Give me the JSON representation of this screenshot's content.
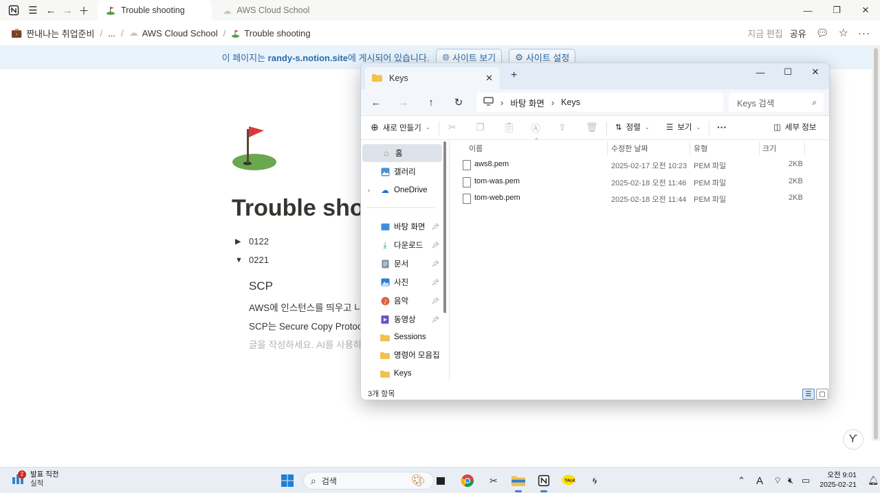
{
  "notion": {
    "tabs": [
      {
        "label": "Trouble shooting",
        "active": true
      },
      {
        "label": "AWS Cloud School",
        "active": false
      }
    ],
    "breadcrumb": [
      "짠내나는 취업준비",
      "...",
      "AWS Cloud School",
      "Trouble shooting"
    ],
    "header_actions": {
      "edited": "지금 편집",
      "share": "공유"
    },
    "banner": {
      "prefix": "이 페이지는 ",
      "site": "randy-s.notion.site",
      "suffix": "에 게시되어 있습니다.",
      "view_site": "사이트 보기",
      "site_settings": "사이트 설정"
    },
    "page": {
      "title": "Trouble shooting",
      "toggles": [
        {
          "label": "0122",
          "open": false
        },
        {
          "label": "0221",
          "open": true
        }
      ],
      "heading": "SCP",
      "paragraphs": [
        "AWS에 인스턴스를 띄우고 나",
        "SCP는 Secure Copy Protoco"
      ],
      "placeholder": "글을 작성하세요. AI를 사용하"
    }
  },
  "explorer": {
    "tab_title": "Keys",
    "path": [
      "바탕 화면",
      "Keys"
    ],
    "search_placeholder": "Keys 검색",
    "commands": {
      "new": "새로 만들기",
      "sort": "정렬",
      "view": "보기",
      "more": "···",
      "details": "세부 정보"
    },
    "nav_items": [
      {
        "label": "홈",
        "icon": "home-icon",
        "selected": true,
        "pinned": false
      },
      {
        "label": "갤러리",
        "icon": "gallery-icon",
        "selected": false,
        "pinned": false
      },
      {
        "label": "OneDrive",
        "icon": "cloud-icon",
        "selected": false,
        "pinned": false
      },
      {
        "label": "바탕 화면",
        "icon": "desktop-icon",
        "selected": false,
        "pinned": true
      },
      {
        "label": "다운로드",
        "icon": "download-icon",
        "selected": false,
        "pinned": true
      },
      {
        "label": "문서",
        "icon": "document-icon",
        "selected": false,
        "pinned": true
      },
      {
        "label": "사진",
        "icon": "picture-icon",
        "selected": false,
        "pinned": true
      },
      {
        "label": "음악",
        "icon": "music-icon",
        "selected": false,
        "pinned": true
      },
      {
        "label": "동영상",
        "icon": "video-icon",
        "selected": false,
        "pinned": true
      },
      {
        "label": "Sessions",
        "icon": "folder-icon",
        "selected": false,
        "pinned": false
      },
      {
        "label": "명령어 모음집",
        "icon": "folder-icon",
        "selected": false,
        "pinned": false
      },
      {
        "label": "Keys",
        "icon": "folder-icon",
        "selected": false,
        "pinned": false
      }
    ],
    "columns": [
      "이름",
      "수정한 날짜",
      "유형",
      "크기"
    ],
    "files": [
      {
        "name": "aws8.pem",
        "modified": "2025-02-17 오전 10:23",
        "type": "PEM 파일",
        "size": "2KB"
      },
      {
        "name": "tom-was.pem",
        "modified": "2025-02-18 오전 11:46",
        "type": "PEM 파일",
        "size": "2KB"
      },
      {
        "name": "tom-web.pem",
        "modified": "2025-02-18 오전 11:44",
        "type": "PEM 파일",
        "size": "2KB"
      }
    ],
    "status": "3개 항목"
  },
  "taskbar": {
    "weather_title": "발표 직전",
    "weather_sub": "실적",
    "badge": "2",
    "search": "검색",
    "ime": "A",
    "time": "오전 9:01",
    "date": "2025-02-21"
  },
  "colors": {
    "accent": "#2b6aa6",
    "banner_bg": "#e9f3fb",
    "selection": "#dde3ea",
    "folder": "#f2c14e"
  }
}
